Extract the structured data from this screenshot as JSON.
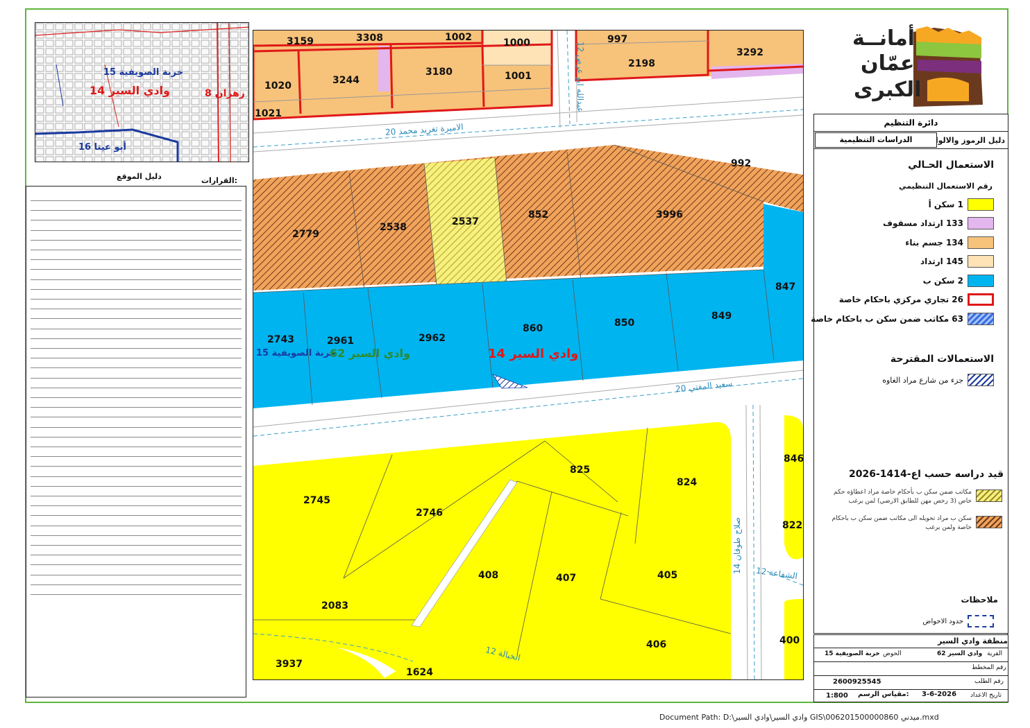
{
  "map": {
    "plots": [
      "3159",
      "3308",
      "1002",
      "1000",
      "997",
      "3292",
      "1020",
      "3244",
      "3180",
      "1001",
      "2198",
      "1021",
      "992",
      "2779",
      "2538",
      "2537",
      "852",
      "3996",
      "847",
      "2743",
      "2961",
      "2962",
      "860",
      "850",
      "849",
      "825",
      "824",
      "846",
      "2745",
      "2746",
      "822",
      "408",
      "407",
      "405",
      "2083",
      "3937",
      "1624",
      "406",
      "400"
    ],
    "streets": {
      "top": "الاميرة تغريد محمد 20",
      "vertical_top": "عبدالله ابو عرص 12",
      "middle": "سعيد المفتي 20",
      "vertical_right": "صلاح طوقان 14",
      "shafaa": "الشفاعة 12",
      "khayala": "الخيالة 12"
    },
    "zone_labels": {
      "label_blue": "15 خربة الصويفية",
      "label_green": "62 وادي السير",
      "label_red": "14 وادي السير"
    }
  },
  "inset": {
    "label1": "15 خربة الصويفية",
    "label2": "14 وادي السير",
    "label3": "8 زهران",
    "label4": "16 أبو عيتا"
  },
  "left_panel": {
    "site_guide": "دليل الموقع",
    "decisions": "القرارات:"
  },
  "logo": {
    "line1": "أمانــة",
    "line2": "عمّان",
    "line3": "الكبرى",
    "colors": {
      "brown": "#6b3a1e",
      "green": "#8dc63f",
      "orange": "#f7a823",
      "purple": "#7b2f7d"
    }
  },
  "legend": {
    "dept": "دائرة التنظيم",
    "guide": "دليل الرموز والالوان",
    "studies": "الدراسات التنظيمية",
    "current_title": "الاستعمال الحـالي",
    "use_number": "رقم الاستعمال التنظيمي",
    "items": [
      {
        "label": "1 سكن أ",
        "color": "#ffff00"
      },
      {
        "label": "133 ارتداد مسقوف",
        "color": "#e3b6ee"
      },
      {
        "label": "134 جسم بناء",
        "color": "#f7c27a"
      },
      {
        "label": "145 ارتداد",
        "color": "#fde3b5"
      },
      {
        "label": "2 سكن ب",
        "color": "#00b4f0"
      },
      {
        "label": "26 تجاري مركزي باحكام خاصة",
        "color": "#ffffff"
      },
      {
        "label": "63 مكاتب ضمن سكن ب باحكام خاصة",
        "color": "#3b6fe0"
      }
    ],
    "proposed_title": "الاستعمالات المقترحة",
    "proposed_item": "جزء من شارع مراد الغاوه",
    "study_title": "قيد دراسه حسب اع-1414-2026",
    "study_item1": "مكاتب ضمن سكن ب بأحكام خاصة مراد اعطاؤه حكم خاص (3 رخص مهن للطابق الارضي) لمن يرغب",
    "study_item2": "سكن ب مراد تحويله الى مكاتب ضمن سكن ب باحكام خاصة ولمن يرغب",
    "notes_title": "ملاحظات",
    "notes_item": "حدود الاحواض"
  },
  "info": {
    "region_label": "منطقة",
    "region": "وادي السير",
    "village_label": "القرية",
    "village": "وادي السير 62",
    "basin_label": "الحوض",
    "basin": "خربة الصويفية 15",
    "plan_no_label": "رقم المخطط",
    "request_no_label": "رقم الطلب",
    "request_no": "2600925545",
    "prep_date_label": "تاريخ الاعداد",
    "prep_date": "3-6-2026",
    "scale_label": "مقياس الرسم:",
    "scale": "1:800"
  },
  "footer": {
    "path": "Document Path: D:\\وادي السير\\وادي السير GIS\\006201500000860 ميدني.mxd"
  }
}
